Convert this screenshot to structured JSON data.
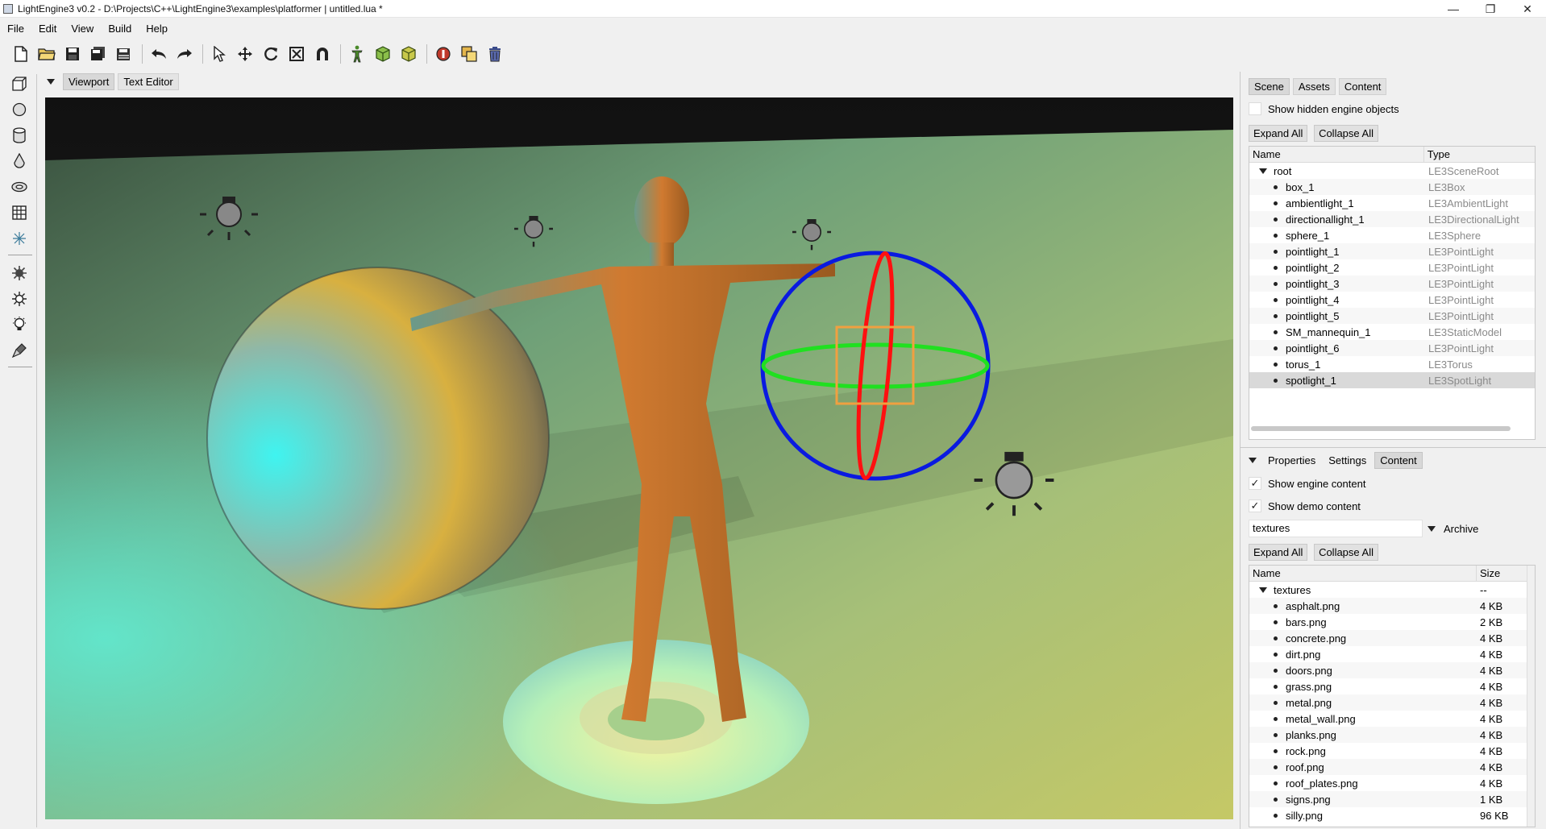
{
  "window": {
    "title": "LightEngine3 v0.2 - D:\\Projects\\C++\\LightEngine3\\examples\\platformer | untitled.lua *",
    "minimize": "—",
    "maximize": "❐",
    "close": "✕"
  },
  "menu": [
    "File",
    "Edit",
    "View",
    "Build",
    "Help"
  ],
  "toolbar": {
    "groups": [
      [
        "new-file-icon",
        "open-folder-icon",
        "save-icon",
        "save-all-icon",
        "save-as-icon"
      ],
      [
        "undo-icon",
        "redo-icon"
      ],
      [
        "select-arrow-icon",
        "move-icon",
        "rotate-icon",
        "scale-icon",
        "snap-magnet-icon"
      ],
      [
        "character-icon",
        "build-box-icon",
        "package-box-icon"
      ],
      [
        "stop-record-icon",
        "duplicate-icon",
        "delete-trash-icon"
      ]
    ]
  },
  "leftbar": {
    "top_tools": [
      "add-box-icon",
      "add-sphere-icon",
      "add-cylinder-icon",
      "add-drop-icon",
      "add-torus-icon",
      "add-grid-icon",
      "add-directional-light-icon",
      "add-ambient-light-icon",
      "add-point-light-icon",
      "add-bulb-icon",
      "add-spotlight-icon"
    ]
  },
  "viewport": {
    "tabs": [
      {
        "label": "Viewport",
        "active": true
      },
      {
        "label": "Text Editor",
        "active": false
      }
    ]
  },
  "scene_panel": {
    "tabs": [
      {
        "label": "Scene",
        "active": true
      },
      {
        "label": "Assets",
        "active": false
      },
      {
        "label": "Content",
        "active": false
      }
    ],
    "show_hidden_label": "Show hidden engine objects",
    "expand_all": "Expand All",
    "collapse_all": "Collapse All",
    "columns": [
      "Name",
      "Type"
    ],
    "root": {
      "name": "root",
      "type": "LE3SceneRoot"
    },
    "items": [
      {
        "name": "box_1",
        "type": "LE3Box"
      },
      {
        "name": "ambientlight_1",
        "type": "LE3AmbientLight"
      },
      {
        "name": "directionallight_1",
        "type": "LE3DirectionalLight"
      },
      {
        "name": "sphere_1",
        "type": "LE3Sphere"
      },
      {
        "name": "pointlight_1",
        "type": "LE3PointLight"
      },
      {
        "name": "pointlight_2",
        "type": "LE3PointLight"
      },
      {
        "name": "pointlight_3",
        "type": "LE3PointLight"
      },
      {
        "name": "pointlight_4",
        "type": "LE3PointLight"
      },
      {
        "name": "pointlight_5",
        "type": "LE3PointLight"
      },
      {
        "name": "SM_mannequin_1",
        "type": "LE3StaticModel"
      },
      {
        "name": "pointlight_6",
        "type": "LE3PointLight"
      },
      {
        "name": "torus_1",
        "type": "LE3Torus"
      },
      {
        "name": "spotlight_1",
        "type": "LE3SpotLight",
        "selected": true
      }
    ]
  },
  "content_panel": {
    "tabs": [
      {
        "label": "Properties",
        "active": false
      },
      {
        "label": "Settings",
        "active": false
      },
      {
        "label": "Content",
        "active": true
      }
    ],
    "show_engine_label": "Show engine content",
    "show_demo_label": "Show demo content",
    "filter_value": "textures",
    "archive_label": "Archive",
    "expand_all": "Expand All",
    "collapse_all": "Collapse All",
    "columns": [
      "Name",
      "Size"
    ],
    "root": {
      "name": "textures",
      "size": "--"
    },
    "items": [
      {
        "name": "asphalt.png",
        "size": "4 KB"
      },
      {
        "name": "bars.png",
        "size": "2 KB"
      },
      {
        "name": "concrete.png",
        "size": "4 KB"
      },
      {
        "name": "dirt.png",
        "size": "4 KB"
      },
      {
        "name": "doors.png",
        "size": "4 KB"
      },
      {
        "name": "grass.png",
        "size": "4 KB"
      },
      {
        "name": "metal.png",
        "size": "4 KB"
      },
      {
        "name": "metal_wall.png",
        "size": "4 KB"
      },
      {
        "name": "planks.png",
        "size": "4 KB"
      },
      {
        "name": "rock.png",
        "size": "4 KB"
      },
      {
        "name": "roof.png",
        "size": "4 KB"
      },
      {
        "name": "roof_plates.png",
        "size": "4 KB"
      },
      {
        "name": "signs.png",
        "size": "1 KB"
      },
      {
        "name": "silly.png",
        "size": "96 KB"
      }
    ]
  }
}
